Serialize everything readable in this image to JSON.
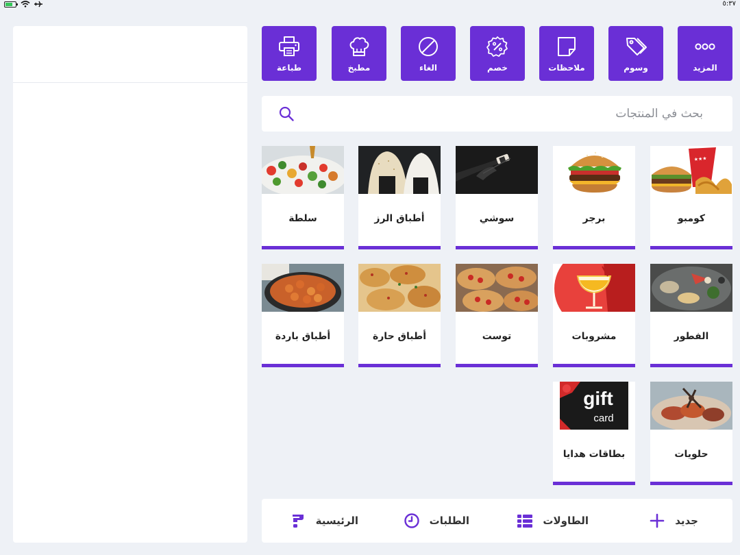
{
  "status_bar": {
    "time": "٥:٣٧"
  },
  "actions": [
    {
      "label": "المزيد",
      "icon": "more-dots-icon"
    },
    {
      "label": "وسوم",
      "icon": "tags-icon"
    },
    {
      "label": "ملاحظات",
      "icon": "note-icon"
    },
    {
      "label": "خصم",
      "icon": "discount-icon"
    },
    {
      "label": "الغاء",
      "icon": "cancel-icon"
    },
    {
      "label": "مطبخ",
      "icon": "chef-hat-icon"
    },
    {
      "label": "طباعة",
      "icon": "printer-icon"
    }
  ],
  "search": {
    "placeholder": "بحث في المنتجات",
    "value": ""
  },
  "products": [
    {
      "name": "كومبو",
      "image": "combo-meal-image"
    },
    {
      "name": "برجر",
      "image": "burger-image"
    },
    {
      "name": "سوشي",
      "image": "sushi-image"
    },
    {
      "name": "أطباق الرز",
      "image": "rice-dishes-image"
    },
    {
      "name": "سلطة",
      "image": "salad-image"
    },
    {
      "name": "الفطور",
      "image": "breakfast-image"
    },
    {
      "name": "مشروبات",
      "image": "drinks-image"
    },
    {
      "name": "توست",
      "image": "toast-image"
    },
    {
      "name": "أطباق حارة",
      "image": "hot-dishes-image"
    },
    {
      "name": "أطباق باردة",
      "image": "cold-dishes-image"
    },
    {
      "name": "حلويات",
      "image": "desserts-image"
    },
    {
      "name": "بطاقات هدايا",
      "image": "gift-card-image"
    }
  ],
  "gift_card": {
    "line1": "gift",
    "line2": "card"
  },
  "bottom_nav": [
    {
      "label": "جديد",
      "icon": "plus-icon"
    },
    {
      "label": "الطاولات",
      "icon": "tables-icon"
    },
    {
      "label": "الطلبات",
      "icon": "clock-icon"
    },
    {
      "label": "الرئيسية",
      "icon": "home-logo-icon"
    }
  ],
  "colors": {
    "accent": "#6a2fd6",
    "background": "#eef1f6",
    "card": "#ffffff"
  }
}
